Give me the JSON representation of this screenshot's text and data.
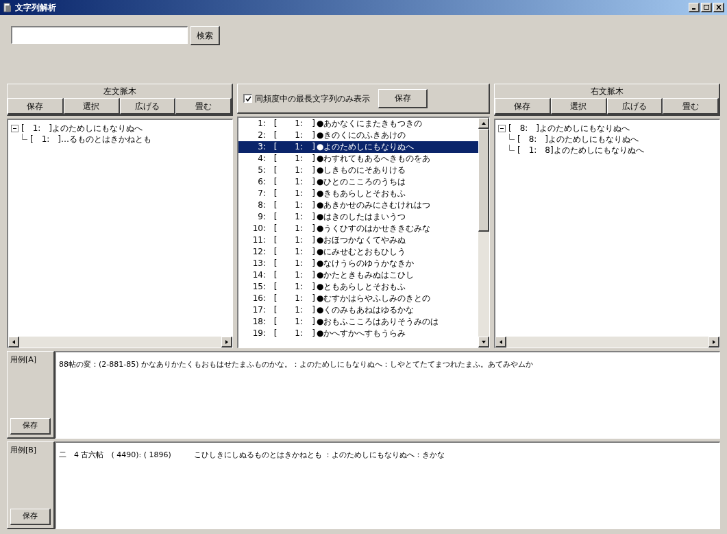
{
  "window": {
    "title": "文字列解析"
  },
  "search": {
    "button": "検索"
  },
  "left_panel": {
    "title": "左文脈木",
    "buttons": [
      "保存",
      "選択",
      "広げる",
      "畳む"
    ],
    "tree": [
      {
        "label": "[　1:　]よのためしにもなりぬへ",
        "expanded": true,
        "children": [
          {
            "label": "[　1:　]…るものとはきかねとも"
          }
        ]
      }
    ]
  },
  "middle_panel": {
    "checkbox": {
      "label": "同頻度中の最長文字列のみ表示",
      "checked": true
    },
    "button": "保存",
    "rows": [
      {
        "number": "1:",
        "open": "[",
        "count": "1:",
        "close": "]",
        "text": "●あかなくにまたきもつきの",
        "selected": false
      },
      {
        "number": "2:",
        "open": "[",
        "count": "1:",
        "close": "]",
        "text": "●きのくにのふきあけの",
        "selected": false
      },
      {
        "number": "3:",
        "open": "[",
        "count": "1:",
        "close": "]",
        "text": "●よのためしにもなりぬへ",
        "selected": true
      },
      {
        "number": "4:",
        "open": "[",
        "count": "1:",
        "close": "]",
        "text": "●わすれてもあるへきものをあ",
        "selected": false
      },
      {
        "number": "5:",
        "open": "[",
        "count": "1:",
        "close": "]",
        "text": "●しきものにそありける",
        "selected": false
      },
      {
        "number": "6:",
        "open": "[",
        "count": "1:",
        "close": "]",
        "text": "●ひとのこころのうちは",
        "selected": false
      },
      {
        "number": "7:",
        "open": "[",
        "count": "1:",
        "close": "]",
        "text": "●きもあらしとそおもふ",
        "selected": false
      },
      {
        "number": "8:",
        "open": "[",
        "count": "1:",
        "close": "]",
        "text": "●あきかせのみにさむけれはつ",
        "selected": false
      },
      {
        "number": "9:",
        "open": "[",
        "count": "1:",
        "close": "]",
        "text": "●はきのしたはまいうつ",
        "selected": false
      },
      {
        "number": "10:",
        "open": "[",
        "count": "1:",
        "close": "]",
        "text": "●うくひすのはかせききむみな",
        "selected": false
      },
      {
        "number": "11:",
        "open": "[",
        "count": "1:",
        "close": "]",
        "text": "●おほつかなくてやみぬ",
        "selected": false
      },
      {
        "number": "12:",
        "open": "[",
        "count": "1:",
        "close": "]",
        "text": "●にみせむとおもひしう",
        "selected": false
      },
      {
        "number": "13:",
        "open": "[",
        "count": "1:",
        "close": "]",
        "text": "●なけうらのゆうかなきか",
        "selected": false
      },
      {
        "number": "14:",
        "open": "[",
        "count": "1:",
        "close": "]",
        "text": "●かたときもみぬはこひし",
        "selected": false
      },
      {
        "number": "15:",
        "open": "[",
        "count": "1:",
        "close": "]",
        "text": "●ともあらしとそおもふ",
        "selected": false
      },
      {
        "number": "16:",
        "open": "[",
        "count": "1:",
        "close": "]",
        "text": "●むすかはらやふしみのきとの",
        "selected": false
      },
      {
        "number": "17:",
        "open": "[",
        "count": "1:",
        "close": "]",
        "text": "●くのみもあねはゆるかな",
        "selected": false
      },
      {
        "number": "18:",
        "open": "[",
        "count": "1:",
        "close": "]",
        "text": "●おもふこころはありそうみのは",
        "selected": false
      },
      {
        "number": "19:",
        "open": "[",
        "count": "1:",
        "close": "]",
        "text": "●かへすかへすもうらみ",
        "selected": false
      }
    ]
  },
  "right_panel": {
    "title": "右文脈木",
    "buttons": [
      "保存",
      "選択",
      "広げる",
      "畳む"
    ],
    "tree": [
      {
        "label": "[　8:　]よのためしにもなりぬへ",
        "expanded": true,
        "children": [
          {
            "label": "[　8:　]よのためしにもなりぬへ"
          },
          {
            "label": "[　1:　8]よのためしにもなりぬへ"
          }
        ]
      }
    ]
  },
  "examples": [
    {
      "label": "用例[A]",
      "text": "88帖の変：(2-881-85) かなありかたくもおもはせたまふものかな。：よのためしにもなりぬへ：しやとてたてまつれたまふ。あてみやムか",
      "button": "保存"
    },
    {
      "label": "用例[B]",
      "text": "二　4 古六帖　( 4490): ( 1896)　　　こひしきにしぬるものとはきかねとも ：よのためしにもなりぬへ：きかな",
      "button": "保存"
    }
  ]
}
